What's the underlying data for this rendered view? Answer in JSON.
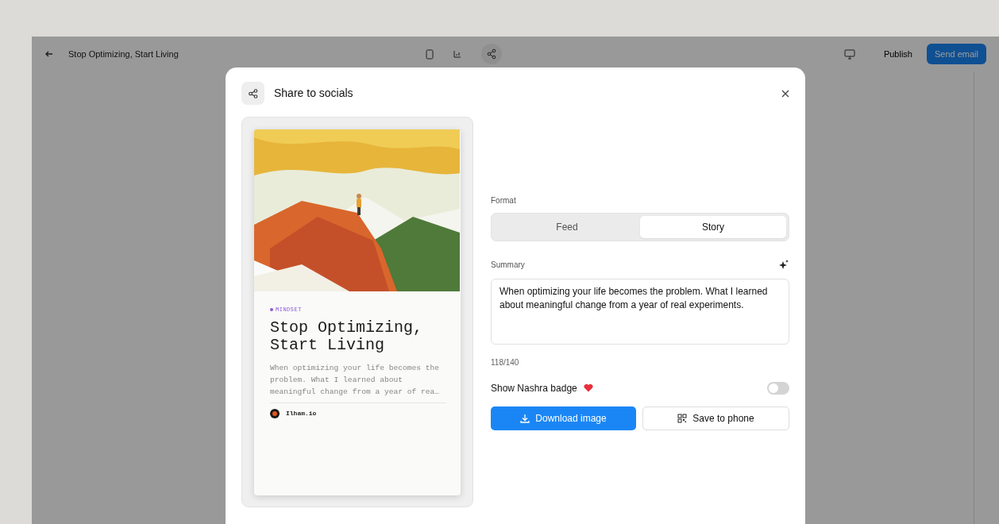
{
  "app_bar": {
    "title": "Stop Optimizing, Start Living",
    "buttons": [
      "Publish",
      "Send email"
    ]
  },
  "dialog": {
    "title": "Share to socials",
    "preview": {
      "category": "MINDSET",
      "headline": "Stop Optimizing, Start Living",
      "excerpt": "When optimizing your life becomes the problem. What I learned about meaningful change from a year of rea…",
      "author": "Ilham.io"
    },
    "format": {
      "label": "Format",
      "options": [
        {
          "label": "Feed",
          "selected": false
        },
        {
          "label": "Story",
          "selected": true
        }
      ]
    },
    "summary": {
      "label": "Summary",
      "value": "When optimizing your life becomes the problem. What I learned about meaningful change from a year of real experiments.",
      "counter": "118/140"
    },
    "badge_toggle": {
      "label": "Show Nashra badge",
      "on": false
    },
    "actions": [
      "Download image",
      "Save to phone"
    ]
  }
}
